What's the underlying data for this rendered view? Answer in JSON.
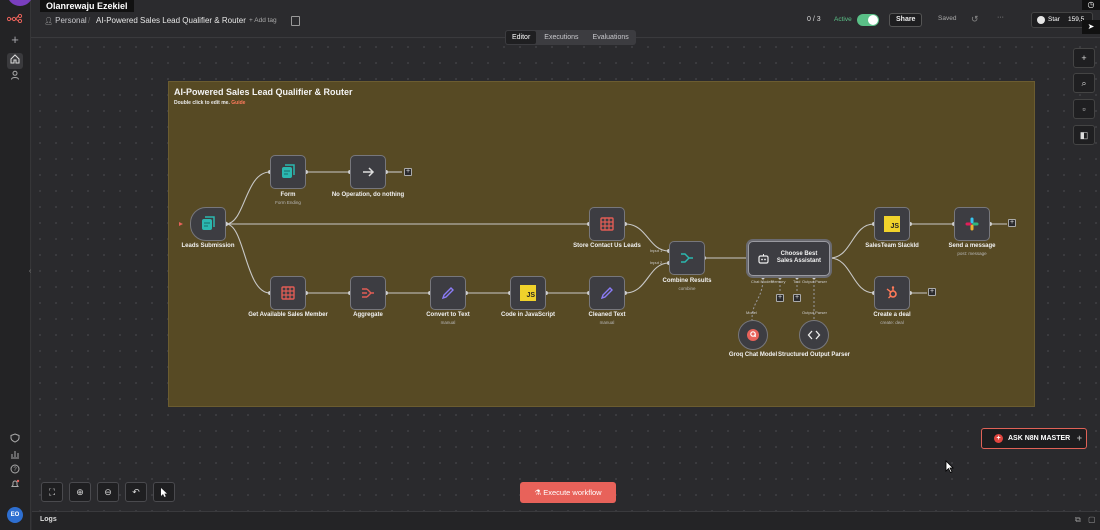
{
  "user": {
    "name": "Olanrewaju Ezekiel",
    "initials": "EO"
  },
  "header": {
    "project": "Personal",
    "workflow_title": "AI-Powered Sales Lead Qualifier & Router",
    "add_tag": "+ Add tag",
    "counter": "0 / 3",
    "active_label": "Active",
    "share_label": "Share",
    "saved_label": "Saved",
    "more_label": "···",
    "star_label": "Star",
    "star_count": "159,5"
  },
  "tabs": [
    {
      "label": "Editor",
      "active": true
    },
    {
      "label": "Executions",
      "active": false
    },
    {
      "label": "Evaluations",
      "active": false
    }
  ],
  "sticky": {
    "title": "AI-Powered Sales Lead Qualifier & Router",
    "subtitle": "Double click to edit me.",
    "guide_link": "Guide",
    "color": "#574a24"
  },
  "nodes": {
    "leads_submission": {
      "label": "Leads Submission"
    },
    "form": {
      "label": "Form",
      "sub": "Form Ending"
    },
    "no_op": {
      "label": "No Operation, do nothing"
    },
    "store_contact": {
      "label": "Store Contact Us Leads"
    },
    "get_sales": {
      "label": "Get Available Sales Member"
    },
    "aggregate": {
      "label": "Aggregate"
    },
    "convert_text": {
      "label": "Convert to Text",
      "sub": "manual"
    },
    "code_js": {
      "label": "Code in JavaScript"
    },
    "cleaned_text": {
      "label": "Cleaned Text",
      "sub": "manual"
    },
    "combine": {
      "label": "Combine Results",
      "sub": "combine",
      "input1": "Input 1",
      "input2": "Input 2"
    },
    "agent": {
      "label": "Choose Best Sales Assistant",
      "port_chat": "Chat Model*",
      "port_memory": "Memory",
      "port_tool": "Tool",
      "port_parser": "Output Parser"
    },
    "groq": {
      "label": "Groq Chat Model",
      "port": "Model"
    },
    "parser": {
      "label": "Structured Output Parser",
      "port": "Output Parser"
    },
    "slack_id": {
      "label": "SalesTeam SlackId"
    },
    "send_msg": {
      "label": "Send a message",
      "sub": "post: message"
    },
    "create_deal": {
      "label": "Create a deal",
      "sub": "create: deal"
    }
  },
  "controls": {
    "execute_label": "Execute workflow",
    "ask_label": "ASK N8N MASTER",
    "logs_label": "Logs"
  },
  "colors": {
    "accent": "#e8625a",
    "active_green": "#5ac087",
    "teal": "#2bb8b0"
  }
}
